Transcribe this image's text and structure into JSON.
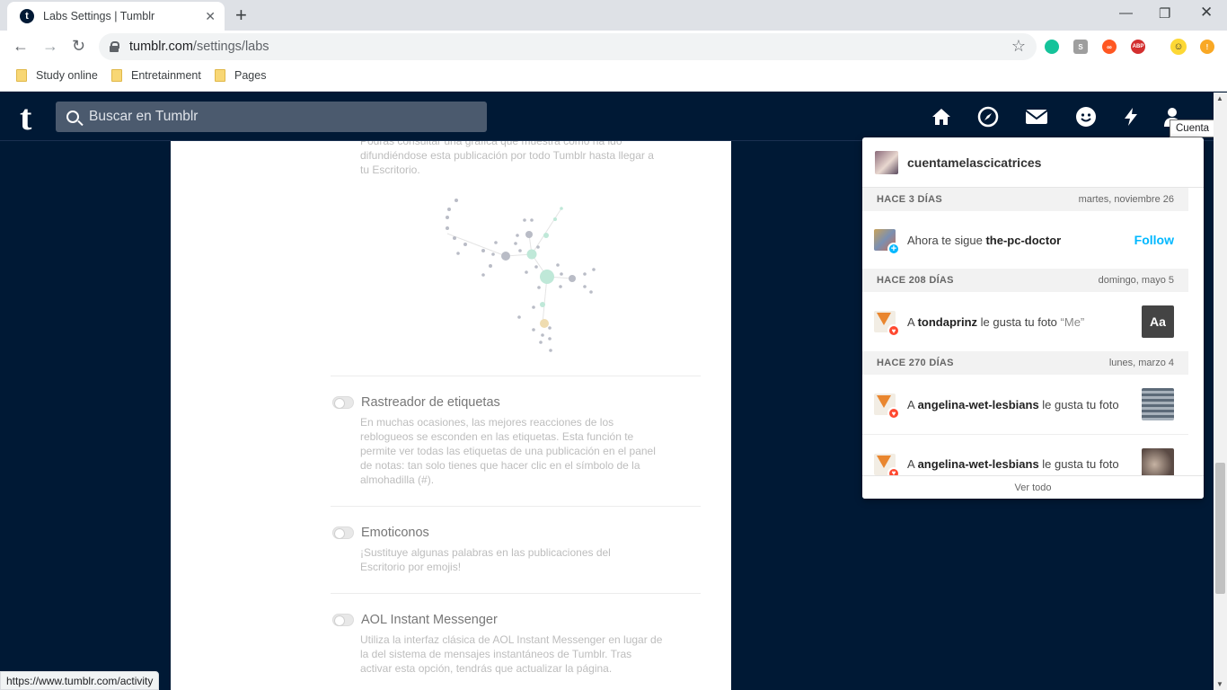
{
  "browser": {
    "tab_title": "Labs Settings | Tumblr",
    "tab_favicon": "t",
    "url_host": "tumblr.com",
    "url_path": "/settings/labs",
    "bookmarks": [
      "Study online",
      "Entretainment",
      "Pages"
    ],
    "extensions": [
      "grammarly-icon",
      "s-icon",
      "infinity-icon",
      "abp-icon",
      "smiley-icon",
      "alert-icon"
    ],
    "ext_labels": {
      "s": "S",
      "abp": "ABP",
      "alert": "!"
    },
    "status_url": "https://www.tumblr.com/activity"
  },
  "tumblr": {
    "logo": "t",
    "search_placeholder": "Buscar en Tumblr",
    "tooltip": "Cuenta",
    "nav_icons": [
      "home-icon",
      "explore-icon",
      "inbox-icon",
      "messaging-icon",
      "activity-icon",
      "account-icon"
    ]
  },
  "labs": {
    "intro_text": "Podrás consultar una gráfica que muestra cómo ha ido difundiéndose esta publicación por todo Tumblr hasta llegar a tu Escritorio.",
    "settings": [
      {
        "title": "Rastreador de etiquetas",
        "description": "En muchas ocasiones, las mejores reacciones de los reblogueos se esconden en las etiquetas. Esta función te permite ver todas las etiquetas de una publicación en el panel de notas: tan solo tienes que hacer clic en el símbolo de la almohadilla (#).",
        "enabled": false
      },
      {
        "title": "Emoticonos",
        "description": "¡Sustituye algunas palabras en las publicaciones del Escritorio por emojis!",
        "enabled": false
      },
      {
        "title": "AOL Instant Messenger",
        "description": "Utiliza la interfaz clásica de AOL Instant Messenger en lugar de la del sistema de mensajes instantáneos de Tumblr. Tras activar esta opción, tendrás que actualizar la página.",
        "enabled": false
      }
    ]
  },
  "activity": {
    "username": "cuentamelascicatrices",
    "groups": [
      {
        "ago": "HACE 3 DÍAS",
        "date": "martes, noviembre 26",
        "items": [
          {
            "pre": "Ahora te sigue ",
            "user": "the-pc-doctor",
            "post": "",
            "quote": "",
            "action": "Follow",
            "kind": "follow"
          }
        ]
      },
      {
        "ago": "HACE 208 DÍAS",
        "date": "domingo, mayo 5",
        "items": [
          {
            "pre": "A ",
            "user": "tondaprinz",
            "post": " le gusta tu foto ",
            "quote": "“Me”",
            "thumb_text": "Aa",
            "kind": "like"
          }
        ]
      },
      {
        "ago": "HACE 270 DÍAS",
        "date": "lunes, marzo 4",
        "items": [
          {
            "pre": "A ",
            "user": "angelina-wet-lesbians",
            "post": " le gusta tu foto",
            "quote": "",
            "kind": "like"
          },
          {
            "pre": "A ",
            "user": "angelina-wet-lesbians",
            "post": " le gusta tu foto",
            "quote": "",
            "kind": "like"
          }
        ]
      }
    ],
    "footer": "Ver todo",
    "colors": {
      "follow": "#00b8ff",
      "like_badge": "#ff4930",
      "follow_badge": "#00b8ff"
    }
  }
}
